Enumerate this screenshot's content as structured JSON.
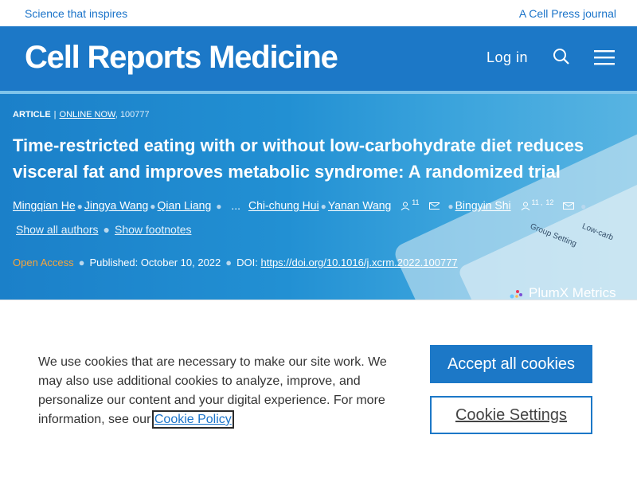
{
  "topbar": {
    "tagline": "Science that inspires",
    "journal_note": "A Cell Press journal"
  },
  "header": {
    "logo": "Cell Reports Medicine",
    "login": "Log in"
  },
  "article": {
    "type": "ARTICLE",
    "status": "ONLINE NOW",
    "number": ", 100777",
    "title": "Time-restricted eating with or without low-carbohydrate diet reduces visceral fat and improves metabolic syndrome: A randomized trial",
    "authors": [
      "Mingqian He",
      "Jingya Wang",
      "Qian Liang",
      "...",
      "Chi-chung Hui",
      "Yanan Wang",
      "Bingyin Shi"
    ],
    "yanan_sup": "11",
    "bingyin_sup1": "11",
    "bingyin_sup2": "12",
    "show_all_authors": "Show all authors",
    "show_footnotes": "Show footnotes",
    "open_access": "Open Access",
    "published_label": "Published:",
    "published_date": "October 10, 2022",
    "doi_label": "DOI:",
    "doi": "https://doi.org/10.1016/j.xcrm.2022.100777",
    "plumx": "PlumX Metrics"
  },
  "hero_image_text": {
    "group_setting": "Group Setting",
    "low_carb": "Low-carb"
  },
  "cookie": {
    "text": "We use cookies that are necessary to make our site work. We may also use additional cookies to analyze, improve, and personalize our content and your digital experience. For more information, see our",
    "policy_link": "Cookie Policy",
    "accept": "Accept all cookies",
    "settings": "Cookie Settings"
  },
  "colors": {
    "brand_blue": "#1c78c7",
    "open_access_orange": "#f7a53c"
  }
}
